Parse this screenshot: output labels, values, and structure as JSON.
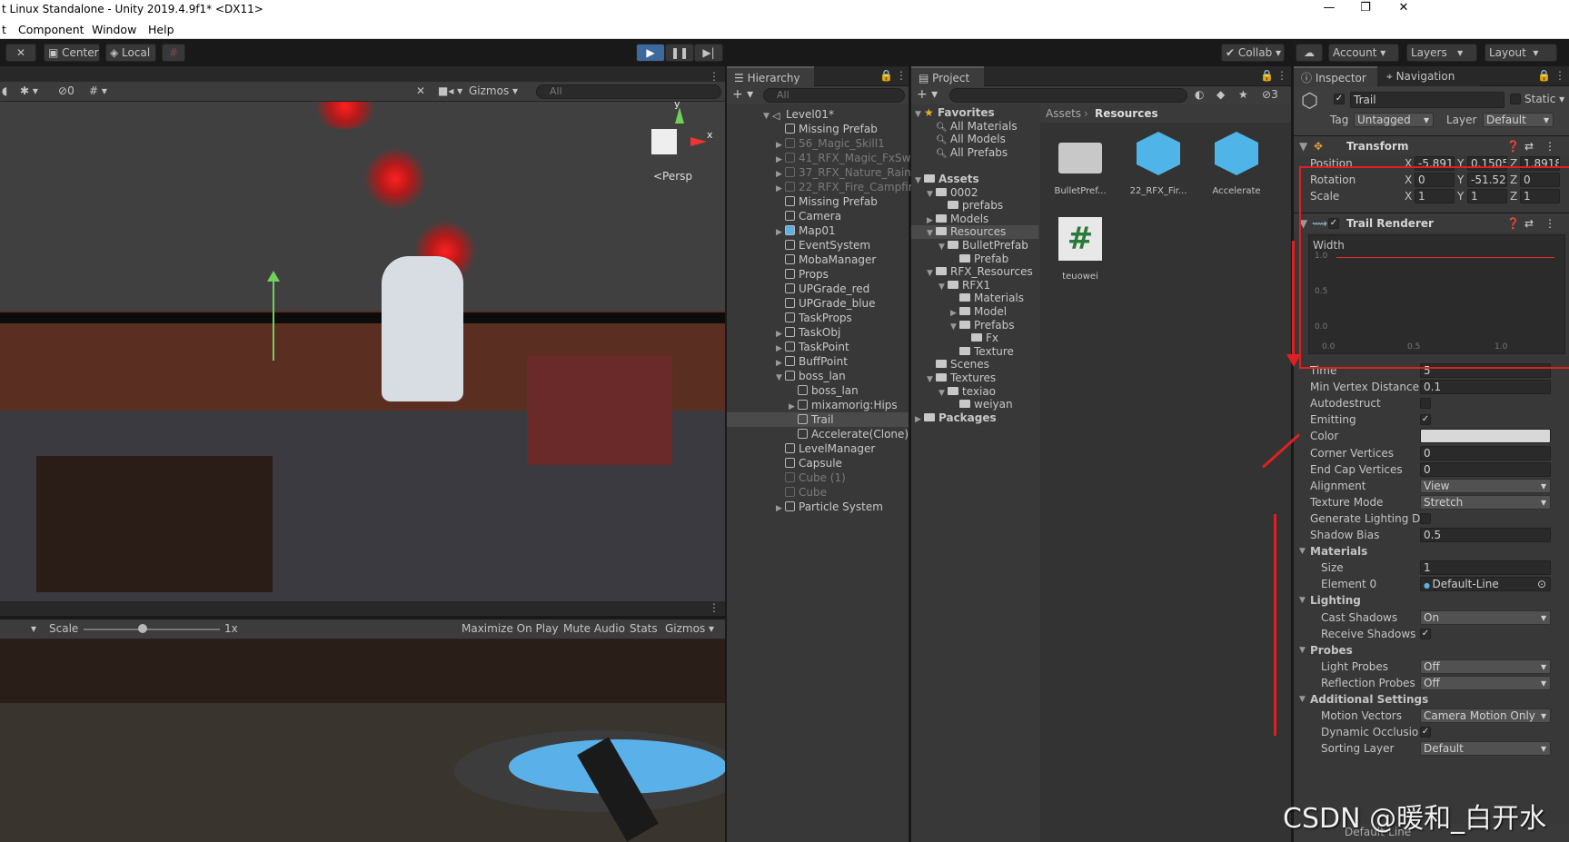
{
  "window": {
    "title": "t Linux Standalone - Unity 2019.4.9f1* <DX11>",
    "min": "—",
    "max": "❐",
    "close": "✕"
  },
  "menu": [
    "t",
    "Component",
    "Window",
    "Help"
  ],
  "toolbar": {
    "center": "Center",
    "local": "Local",
    "collab": "Collab",
    "account": "Account",
    "layers": "Layers",
    "layout": "Layout"
  },
  "scene": {
    "gizmos": "Gizmos",
    "search_placeholder": "All",
    "persp": "<Persp",
    "hidden_count": "0",
    "axis_y": "y",
    "axis_x": "x"
  },
  "game": {
    "scale_label": "Scale",
    "scale_value": "1x",
    "maximize": "Maximize On Play",
    "mute": "Mute Audio",
    "stats": "Stats",
    "gizmos": "Gizmos"
  },
  "hierarchy": {
    "tab": "Hierarchy",
    "search_placeholder": "All",
    "items": [
      {
        "label": "Level01*",
        "indent": 0,
        "fold": "▼",
        "kind": "scene"
      },
      {
        "label": "Missing Prefab",
        "indent": 1,
        "fold": "",
        "kind": "obj"
      },
      {
        "label": "56_Magic_Skill1",
        "indent": 1,
        "fold": "▶",
        "kind": "dim"
      },
      {
        "label": "41_RFX_Magic_FxSwc",
        "indent": 1,
        "fold": "▶",
        "kind": "dim"
      },
      {
        "label": "37_RFX_Nature_Rain2",
        "indent": 1,
        "fold": "▶",
        "kind": "dim"
      },
      {
        "label": "22_RFX_Fire_Campfire",
        "indent": 1,
        "fold": "▶",
        "kind": "dim"
      },
      {
        "label": "Missing Prefab",
        "indent": 1,
        "fold": "",
        "kind": "obj"
      },
      {
        "label": "Camera",
        "indent": 1,
        "fold": "",
        "kind": "obj"
      },
      {
        "label": "Map01",
        "indent": 1,
        "fold": "▶",
        "kind": "prefab"
      },
      {
        "label": "EventSystem",
        "indent": 1,
        "fold": "",
        "kind": "obj"
      },
      {
        "label": "MobaManager",
        "indent": 1,
        "fold": "",
        "kind": "obj"
      },
      {
        "label": "Props",
        "indent": 1,
        "fold": "",
        "kind": "obj"
      },
      {
        "label": "UPGrade_red",
        "indent": 1,
        "fold": "",
        "kind": "obj"
      },
      {
        "label": "UPGrade_blue",
        "indent": 1,
        "fold": "",
        "kind": "obj"
      },
      {
        "label": "TaskProps",
        "indent": 1,
        "fold": "",
        "kind": "obj"
      },
      {
        "label": "TaskObj",
        "indent": 1,
        "fold": "▶",
        "kind": "obj"
      },
      {
        "label": "TaskPoint",
        "indent": 1,
        "fold": "▶",
        "kind": "obj"
      },
      {
        "label": "BuffPoint",
        "indent": 1,
        "fold": "▶",
        "kind": "obj"
      },
      {
        "label": "boss_lan",
        "indent": 1,
        "fold": "▼",
        "kind": "obj"
      },
      {
        "label": "boss_lan",
        "indent": 2,
        "fold": "",
        "kind": "obj"
      },
      {
        "label": "mixamorig:Hips",
        "indent": 2,
        "fold": "▶",
        "kind": "obj"
      },
      {
        "label": "Trail",
        "indent": 2,
        "fold": "",
        "kind": "sel"
      },
      {
        "label": "Accelerate(Clone)",
        "indent": 2,
        "fold": "",
        "kind": "obj"
      },
      {
        "label": "LevelManager",
        "indent": 1,
        "fold": "",
        "kind": "obj"
      },
      {
        "label": "Capsule",
        "indent": 1,
        "fold": "",
        "kind": "obj"
      },
      {
        "label": "Cube (1)",
        "indent": 1,
        "fold": "",
        "kind": "dim"
      },
      {
        "label": "Cube",
        "indent": 1,
        "fold": "",
        "kind": "dim"
      },
      {
        "label": "Particle System",
        "indent": 1,
        "fold": "▶",
        "kind": "obj"
      }
    ]
  },
  "project": {
    "tab": "Project",
    "breadcrumb": [
      "Assets",
      "Resources"
    ],
    "hidden_count": "3",
    "tree": [
      {
        "label": "Favorites",
        "indent": 0,
        "fold": "▼",
        "kind": "star"
      },
      {
        "label": "All Materials",
        "indent": 1,
        "fold": "",
        "kind": "search"
      },
      {
        "label": "All Models",
        "indent": 1,
        "fold": "",
        "kind": "search"
      },
      {
        "label": "All Prefabs",
        "indent": 1,
        "fold": "",
        "kind": "search"
      },
      {
        "label": "",
        "indent": 0,
        "fold": "",
        "kind": "gap"
      },
      {
        "label": "Assets",
        "indent": 0,
        "fold": "▼",
        "kind": "bold"
      },
      {
        "label": "0002",
        "indent": 1,
        "fold": "▼",
        "kind": "folder"
      },
      {
        "label": "prefabs",
        "indent": 2,
        "fold": "",
        "kind": "folder"
      },
      {
        "label": "Models",
        "indent": 1,
        "fold": "▶",
        "kind": "folder"
      },
      {
        "label": "Resources",
        "indent": 1,
        "fold": "▼",
        "kind": "selfolder"
      },
      {
        "label": "BulletPrefab",
        "indent": 2,
        "fold": "▼",
        "kind": "folder"
      },
      {
        "label": "Prefab",
        "indent": 3,
        "fold": "",
        "kind": "folder"
      },
      {
        "label": "RFX_Resources",
        "indent": 1,
        "fold": "▼",
        "kind": "folder"
      },
      {
        "label": "RFX1",
        "indent": 2,
        "fold": "▼",
        "kind": "folder"
      },
      {
        "label": "Materials",
        "indent": 3,
        "fold": "",
        "kind": "folder"
      },
      {
        "label": "Model",
        "indent": 3,
        "fold": "▶",
        "kind": "folder"
      },
      {
        "label": "Prefabs",
        "indent": 3,
        "fold": "▼",
        "kind": "folder"
      },
      {
        "label": "Fx",
        "indent": 4,
        "fold": "",
        "kind": "folder"
      },
      {
        "label": "Texture",
        "indent": 3,
        "fold": "",
        "kind": "folder"
      },
      {
        "label": "Scenes",
        "indent": 1,
        "fold": "",
        "kind": "folder"
      },
      {
        "label": "Textures",
        "indent": 1,
        "fold": "▼",
        "kind": "folder"
      },
      {
        "label": "texiao",
        "indent": 2,
        "fold": "▼",
        "kind": "folder"
      },
      {
        "label": "weiyan",
        "indent": 3,
        "fold": "",
        "kind": "folder"
      },
      {
        "label": "Packages",
        "indent": 0,
        "fold": "▶",
        "kind": "bold"
      }
    ],
    "assets": [
      {
        "label": "BulletPref...",
        "icon": "folder"
      },
      {
        "label": "22_RFX_Fir...",
        "icon": "cube"
      },
      {
        "label": "Accelerate",
        "icon": "cube"
      },
      {
        "label": "teuowei",
        "icon": "script"
      }
    ]
  },
  "inspector": {
    "tab": "Inspector",
    "tab2": "Navigation",
    "object_name": "Trail",
    "static": "Static",
    "tag_label": "Tag",
    "tag_value": "Untagged",
    "layer_label": "Layer",
    "layer_value": "Default",
    "transform": {
      "title": "Transform",
      "rows": [
        {
          "label": "Position",
          "x": "-5.891",
          "y": "0.1505",
          "z": "1.8918"
        },
        {
          "label": "Rotation",
          "x": "0",
          "y": "-51.52",
          "z": "0"
        },
        {
          "label": "Scale",
          "x": "1",
          "y": "1",
          "z": "1"
        }
      ]
    },
    "trail": {
      "title": "Trail Renderer",
      "width_label": "Width",
      "curve_ticks": [
        "1.0",
        "0.5",
        "0.0"
      ],
      "curve_x_ticks": [
        "0.0",
        "0.5",
        "1.0"
      ],
      "props": [
        {
          "label": "Time",
          "type": "field",
          "value": "5"
        },
        {
          "label": "Min Vertex Distance",
          "type": "field",
          "value": "0.1"
        },
        {
          "label": "Autodestruct",
          "type": "check",
          "value": ""
        },
        {
          "label": "Emitting",
          "type": "check",
          "value": "✓"
        },
        {
          "label": "Color",
          "type": "color",
          "value": "#d8d8d8"
        },
        {
          "label": "Corner Vertices",
          "type": "field",
          "value": "0"
        },
        {
          "label": "End Cap Vertices",
          "type": "field",
          "value": "0"
        },
        {
          "label": "Alignment",
          "type": "drop",
          "value": "View"
        },
        {
          "label": "Texture Mode",
          "type": "drop",
          "value": "Stretch"
        },
        {
          "label": "Generate Lighting Da",
          "type": "check",
          "value": ""
        },
        {
          "label": "Shadow Bias",
          "type": "field",
          "value": "0.5"
        },
        {
          "label": "Materials",
          "type": "section",
          "value": ""
        },
        {
          "label": "Size",
          "type": "fieldsub",
          "value": "1"
        },
        {
          "label": "Element 0",
          "type": "objsub",
          "value": "Default-Line"
        },
        {
          "label": "Lighting",
          "type": "section",
          "value": ""
        },
        {
          "label": "Cast Shadows",
          "type": "dropsub",
          "value": "On"
        },
        {
          "label": "Receive Shadows",
          "type": "checksub",
          "value": "✓"
        },
        {
          "label": "Probes",
          "type": "section",
          "value": ""
        },
        {
          "label": "Light Probes",
          "type": "dropsub",
          "value": "Off"
        },
        {
          "label": "Reflection Probes",
          "type": "dropsub",
          "value": "Off"
        },
        {
          "label": "Additional Settings",
          "type": "section",
          "value": ""
        },
        {
          "label": "Motion Vectors",
          "type": "dropsub",
          "value": "Camera Motion Only"
        },
        {
          "label": "Dynamic Occlusio",
          "type": "checksub",
          "value": "✓"
        },
        {
          "label": "Sorting Layer",
          "type": "dropsub",
          "value": "Default"
        }
      ],
      "bottom_material": "Default-Line"
    }
  },
  "watermark": "CSDN @暖和_白开水",
  "colors": {
    "accent": "#3d6a9e",
    "annotation": "#e02020",
    "panel": "#383838",
    "selected": "#4a4a4a"
  }
}
